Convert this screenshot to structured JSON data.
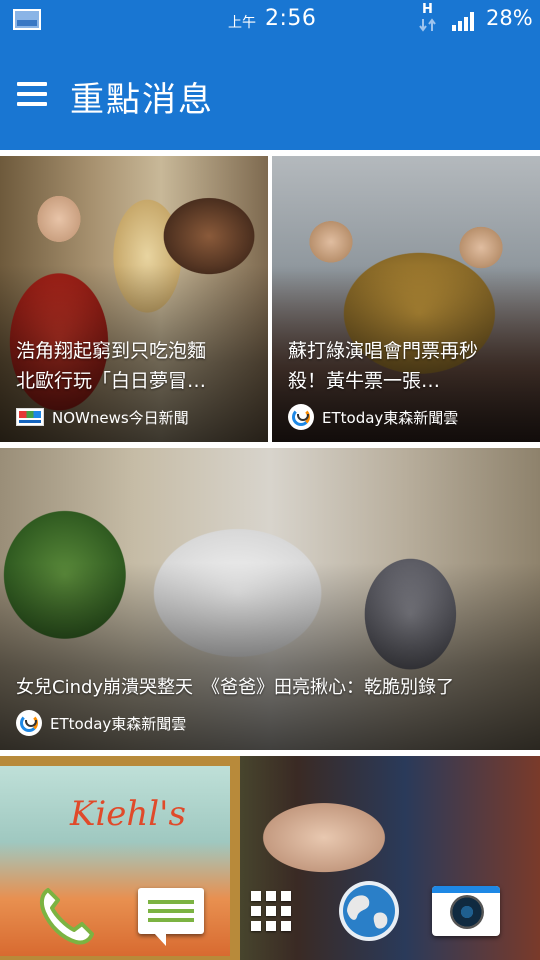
{
  "status_bar": {
    "ampm": "上午",
    "time": "2:56",
    "network_letter": "H",
    "battery": "28%"
  },
  "app_bar": {
    "title": "重點消息"
  },
  "cards": [
    {
      "title_line1": "浩角翔起窮到只吃泡麵",
      "title_line2": "北歐行玩「白日夢冒…",
      "source": "NOWnews今日新聞"
    },
    {
      "title_line1": "蘇打綠演唱會門票再秒",
      "title_line2": "殺！黃牛票一張…",
      "source": "ETtoday東森新聞雲"
    },
    {
      "title_line1": "女兒Cindy崩潰哭整天　《爸爸》田亮揪心：乾脆別錄了",
      "source": "ETtoday東森新聞雲"
    },
    {
      "sign_text": "Kiehl's"
    }
  ],
  "dock": [
    {
      "icon": "phone-icon"
    },
    {
      "icon": "messages-icon"
    },
    {
      "icon": "app-drawer-icon"
    },
    {
      "icon": "browser-globe-icon"
    },
    {
      "icon": "camera-icon"
    }
  ],
  "colors": {
    "app_bar": "#1976d2",
    "background": "#ffffff"
  }
}
